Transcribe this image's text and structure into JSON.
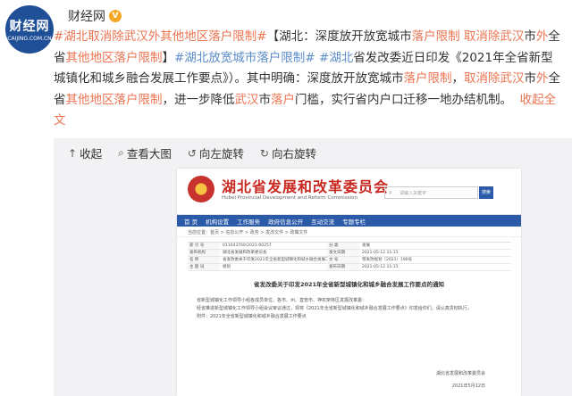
{
  "author": {
    "avatar_text": "财经网",
    "avatar_sub": "CAIJING.COM.CN",
    "name": "财经网"
  },
  "post": {
    "tag1": "#湖北取消除武汉外其他地区落户限制#",
    "seg1": "【湖北：深度放开放宽城市",
    "kw1": "落户限制",
    "seg2": " ",
    "kw2": "取消除武汉",
    "seg3": "市",
    "kw3": "外",
    "seg4": "全省",
    "kw4": "其他地区落户限制",
    "seg5": "】",
    "tag2": "#湖北放宽城市落户限制#",
    "seg6": " ",
    "tag3": "#湖北",
    "seg7": "省发改委近日印发《2021年全省新型城镇化和城乡融合发展工作要点》）。其中明确：深度放开放宽城市",
    "kw5": "落户限制",
    "seg8": "，",
    "kw6": "取消除武汉",
    "seg9": "市",
    "kw7": "外",
    "seg10": "全省",
    "kw8": "其他地区落户限制",
    "seg11": "，进一步降低",
    "kw9": "武汉",
    "seg12": "市",
    "kw10": "落户",
    "seg13": "门槛，实行省内户口迁移一地办结机制。",
    "more": "收起全文"
  },
  "toolbar": {
    "collapse": "收起",
    "view_large": "查看大图",
    "rotate_left": "向左旋转",
    "rotate_right": "向右旋转"
  },
  "shot": {
    "title": "湖北省发展和改革委员会",
    "subtitle": "Hubei Provincial Development and Reform Commission",
    "search_placeholder": "请输入关键字",
    "search_btn": "搜索",
    "nav": [
      "首 页",
      "机构设置",
      "工作服务",
      "政府信息公开",
      "互动交流",
      "专题专栏"
    ],
    "crumb": "当前位置：首页 > 信息公开 > 政务 > 发改文件 > 政策文件",
    "meta": [
      {
        "k": "索 引 号",
        "v": "011043760/2021-00257",
        "k2": "分 类",
        "v2": "发展"
      },
      {
        "k": "发布机构",
        "v": "湖北省发展和改革委员会",
        "k2": "发文日期",
        "v2": "2021-05-12 11:15"
      },
      {
        "k": "名 称",
        "v": "省发改委关于印发2021年全省新型城镇化和城乡融合发展工作要点的通知",
        "k2": "文 号",
        "v2": "鄂发改规划〔2021〕190号"
      },
      {
        "k": "主 题 词",
        "v": "规划",
        "k2": "发布日期",
        "v2": "2021-05-12 11:15"
      }
    ],
    "doc_title": "省发改委关于印发2021年全省新型城镇化和城乡融合发展工作要点的通知",
    "para1": "省新型城镇化工作领导小组各成员单位、各市、州、直管市、神农架林区发展改革委：",
    "para2": "经省推进新型城镇化工作领导小组会议审议通过，现将《2021年全省新型城镇化和城乡融合发展工作要点》印发给你们，请认真贯彻执行。",
    "para3": "附件：2021年全省新型城镇化和城乡融合发展工作要点",
    "sign1": "湖北省发展和改革委员会",
    "sign2": "2021年5月12日"
  },
  "colors": {
    "accent": "#eb7350",
    "link": "#5a8cc8",
    "gov_red": "#c8281f",
    "gov_blue": "#2a5aa8"
  }
}
